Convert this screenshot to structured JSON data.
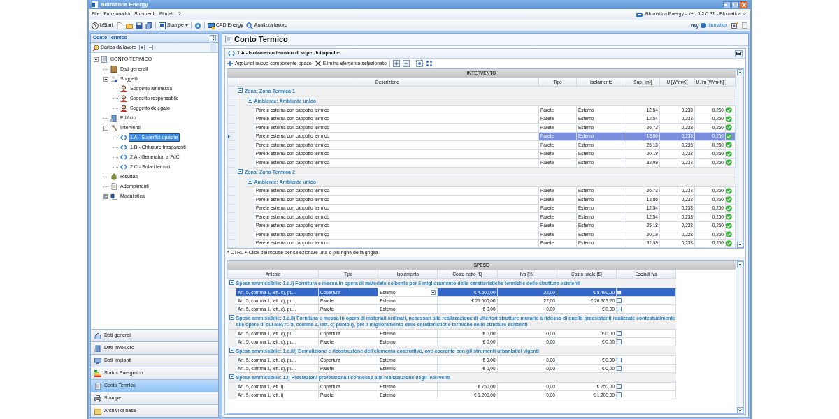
{
  "window": {
    "title": "Blumatica Energy"
  },
  "menu": [
    "File",
    "Funzionalità",
    "Strumenti",
    "Filmati",
    "?"
  ],
  "version": "Blumatica Energy - ver. 6.2.0.31 - Blumatica srl",
  "toolbar": [
    {
      "kind": "start",
      "label": "bStart"
    },
    {
      "kind": "new"
    },
    {
      "kind": "open"
    },
    {
      "kind": "save"
    },
    {
      "kind": "saveall"
    },
    {
      "kind": "sep"
    },
    {
      "kind": "print",
      "label": "Stampe"
    },
    {
      "kind": "sep"
    },
    {
      "kind": "gear"
    },
    {
      "kind": "sep"
    },
    {
      "kind": "cad",
      "label": "CAD Energy"
    },
    {
      "kind": "analyze",
      "label": "Analizza lavoro"
    }
  ],
  "brand": {
    "prefix": "my",
    "name": "blumatica"
  },
  "sidebar": {
    "title": "Conto Termico",
    "load_button": "Carica da lavoro",
    "tree": [
      {
        "label": "CONTO TERMICO",
        "kind": "list",
        "expanded": true,
        "selected": false,
        "children": [
          {
            "label": "Dati generali",
            "kind": "book",
            "selected": false
          },
          {
            "label": "Soggetti",
            "kind": "people",
            "expanded": true,
            "selected": false,
            "children": [
              {
                "label": "Soggetto ammesso",
                "kind": "person",
                "selected": false
              },
              {
                "label": "Soggetto responsabile",
                "kind": "person",
                "selected": false
              },
              {
                "label": "Soggetto delegato",
                "kind": "person",
                "selected": false
              }
            ]
          },
          {
            "label": "Edificio",
            "kind": "building",
            "selected": false
          },
          {
            "label": "Interventi",
            "kind": "hammer",
            "expanded": true,
            "selected": false,
            "children": [
              {
                "label": "1.A - Superfici opache",
                "kind": "code",
                "selected": true
              },
              {
                "label": "1.B - Chiusure trasparenti",
                "kind": "code",
                "selected": false
              },
              {
                "label": "2.A - Generatori a PdC",
                "kind": "code",
                "selected": false
              },
              {
                "label": "2.C - Solari termici",
                "kind": "code",
                "selected": false
              }
            ]
          },
          {
            "label": "Risultati",
            "kind": "money",
            "selected": false
          },
          {
            "label": "Adempimenti",
            "kind": "doc",
            "selected": false
          },
          {
            "label": "Modulistica",
            "kind": "word",
            "expanded": false,
            "selected": false
          }
        ]
      }
    ],
    "nav": [
      {
        "label": "Dati generali",
        "kind": "house",
        "selected": false
      },
      {
        "label": "Dati Involucro",
        "kind": "building",
        "selected": false
      },
      {
        "label": "Dati Impianti",
        "kind": "plant",
        "selected": false
      },
      {
        "label": "Status Energetico",
        "kind": "energy",
        "selected": false
      },
      {
        "label": "Conto Termico",
        "kind": "list",
        "selected": true
      },
      {
        "label": "Stampe",
        "kind": "printer",
        "selected": false
      },
      {
        "label": "Archivi di base",
        "kind": "archive",
        "selected": false
      }
    ]
  },
  "main": {
    "title": "Conto Termico",
    "section": "1.A - Isolamento termico di superfici opache",
    "actions": [
      {
        "kind": "add",
        "label": "Aggiungi nuovo componente opaco"
      },
      {
        "kind": "delete",
        "label": "Elimina elemento selezionato"
      },
      {
        "kind": "sep"
      },
      {
        "kind": "expand"
      },
      {
        "kind": "collapse"
      },
      {
        "kind": "sep"
      },
      {
        "kind": "fit"
      },
      {
        "kind": "fitall"
      }
    ],
    "intervento": {
      "title": "INTERVENTO",
      "columns": [
        "Descrizione",
        "Tipo",
        "Isolamento",
        "Sup. [m²]",
        "U [W/m²K]",
        "U,lim [W/m²K]"
      ],
      "zones": [
        {
          "label": "Zona: Zona Termica 1",
          "expanded": true,
          "ambients": [
            {
              "label": "Ambiente: Ambiente unico",
              "expanded": true,
              "rows": [
                {
                  "cells": [
                    "Parete esterna con cappotto termico",
                    "Parete",
                    "Esterno",
                    "12,54",
                    "0,233",
                    "0,260"
                  ],
                  "ok": true,
                  "selected": false
                },
                {
                  "cells": [
                    "Parete esterna con cappotto termico",
                    "Parete",
                    "Esterno",
                    "12,54",
                    "0,233",
                    "0,260"
                  ],
                  "ok": true,
                  "selected": false
                },
                {
                  "cells": [
                    "Parete esterna con cappotto termico",
                    "Parete",
                    "Esterno",
                    "26,73",
                    "0,233",
                    "0,260"
                  ],
                  "ok": true,
                  "selected": false
                },
                {
                  "cells": [
                    "Parete esterna con cappotto termico",
                    "Parete",
                    "Esterno",
                    "13,86",
                    "0,233",
                    "0,260"
                  ],
                  "ok": true,
                  "selected": true
                },
                {
                  "cells": [
                    "Parete esterna con cappotto termico",
                    "Parete",
                    "Esterno",
                    "25,18",
                    "0,233",
                    "0,260"
                  ],
                  "ok": true,
                  "selected": false
                },
                {
                  "cells": [
                    "Parete esterna con cappotto termico",
                    "Parete",
                    "Esterno",
                    "20,19",
                    "0,233",
                    "0,260"
                  ],
                  "ok": true,
                  "selected": false
                },
                {
                  "cells": [
                    "Parete esterna con cappotto termico",
                    "Parete",
                    "Esterno",
                    "32,99",
                    "0,233",
                    "0,260"
                  ],
                  "ok": true,
                  "selected": false
                }
              ]
            }
          ]
        },
        {
          "label": "Zona: Zona Termica 2",
          "expanded": true,
          "ambients": [
            {
              "label": "Ambiente: Ambiente unico",
              "expanded": true,
              "rows": [
                {
                  "cells": [
                    "Parete esterna con cappotto termico",
                    "Parete",
                    "Esterno",
                    "26,73",
                    "0,233",
                    "0,260"
                  ],
                  "ok": true,
                  "selected": false
                },
                {
                  "cells": [
                    "Parete esterna con cappotto termico",
                    "Parete",
                    "Esterno",
                    "13,86",
                    "0,233",
                    "0,260"
                  ],
                  "ok": true,
                  "selected": false
                },
                {
                  "cells": [
                    "Parete esterna con cappotto termico",
                    "Parete",
                    "Esterno",
                    "12,54",
                    "0,233",
                    "0,260"
                  ],
                  "ok": true,
                  "selected": false
                },
                {
                  "cells": [
                    "Parete esterna con cappotto termico",
                    "Parete",
                    "Esterno",
                    "12,54",
                    "0,233",
                    "0,260"
                  ],
                  "ok": true,
                  "selected": false
                },
                {
                  "cells": [
                    "Parete esterna con cappotto termico",
                    "Parete",
                    "Esterno",
                    "25,18",
                    "0,233",
                    "0,260"
                  ],
                  "ok": true,
                  "selected": false
                },
                {
                  "cells": [
                    "Parete esterna con cappotto termico",
                    "Parete",
                    "Esterno",
                    "20,19",
                    "0,233",
                    "0,260"
                  ],
                  "ok": true,
                  "selected": false
                },
                {
                  "cells": [
                    "Parete esterna con cappotto termico",
                    "Parete",
                    "Esterno",
                    "32,99",
                    "0,233",
                    "0,260"
                  ],
                  "ok": true,
                  "selected": false
                }
              ]
            }
          ]
        }
      ]
    },
    "hint": "* CTRL + Click del mouse per selezionare una o più righe della griglia",
    "spese": {
      "title": "SPESE",
      "columns": [
        "Articolo",
        "Tipo",
        "Isolamento",
        "Costo netto [€]",
        "Iva [%]",
        "Costo totale [€]",
        "Escludi Iva"
      ],
      "groups": [
        {
          "label": "Spesa ammissibile: 1.c.i) Fornitura e messa in opera di materiale coibente per il miglioramento delle caratteristiche termiche delle strutture esistenti",
          "expanded": true,
          "rows": [
            {
              "cells": [
                "Art. 5, comma 1, lett. c), pu...",
                "Copertura",
                "Esterno",
                "€ 4.500,00",
                "22,00",
                "€ 5.490,00"
              ],
              "checked": false,
              "selected": true
            },
            {
              "cells": [
                "Art. 5, comma 1, lett. c), pu...",
                "Parete",
                "Esterno",
                "€ 21.560,00",
                "22,00",
                "€ 26.303,20"
              ],
              "checked": false,
              "selected": false
            },
            {
              "cells": [
                "Art. 5, comma 1, lett. c), pu...",
                "Parete",
                "Esterno",
                "€ 0,00",
                "0,00",
                "€ 0,00"
              ],
              "checked": false,
              "selected": false
            }
          ]
        },
        {
          "label": "Spesa ammissibile: 1.c.ii) Fornitura e messa in opera di materiali ordinari, necessari alla realizzazione di ulteriori strutture murarie a ridosso di quelle preesistenti realizzate contestualmente alle opere di cui allA'rt. 5, comma 1, lett. c) punto i), per il miglioramento delle caratteristiche termiche delle strutture esistenti",
          "expanded": true,
          "rows": [
            {
              "cells": [
                "Art. 5, comma 1, lett. c), pu...",
                "Copertura",
                "Esterno",
                "€ 0,00",
                "0,00",
                "€ 0,00"
              ],
              "checked": false,
              "selected": false
            },
            {
              "cells": [
                "Art. 5, comma 1, lett. c), pu...",
                "Parete",
                "Esterno",
                "€ 0,00",
                "0,00",
                "€ 0,00"
              ],
              "checked": false,
              "selected": false
            }
          ]
        },
        {
          "label": "Spesa ammissibile: 1.c.iii) Demolizione e ricostruzione dell'elemento costruttivo, ove coerente con gli strumenti urbanistici vigenti",
          "expanded": true,
          "rows": [
            {
              "cells": [
                "Art. 5, comma 1, lett. c), pu...",
                "Copertura",
                "Esterno",
                "€ 0,00",
                "0,00",
                "€ 0,00"
              ],
              "checked": false,
              "selected": false
            },
            {
              "cells": [
                "Art. 5, comma 1, lett. c), pu...",
                "Parete",
                "Esterno",
                "€ 0,00",
                "0,00",
                "€ 0,00"
              ],
              "checked": false,
              "selected": false
            }
          ]
        },
        {
          "label": "Spesa ammissibile: 1.i) Prestazioni professionali connesse alla realizzazione degli interventi",
          "expanded": true,
          "rows": [
            {
              "cells": [
                "Art. 5, comma 1, lett. i)",
                "Copertura",
                "Esterno",
                "€ 750,00",
                "0,00",
                "€ 750,00"
              ],
              "checked": false,
              "selected": false
            },
            {
              "cells": [
                "Art. 5, comma 1, lett. i)",
                "Parete",
                "Esterno",
                "€ 1.200,00",
                "0,00",
                "€ 1.200,00"
              ],
              "checked": false,
              "selected": false
            }
          ]
        }
      ]
    }
  }
}
